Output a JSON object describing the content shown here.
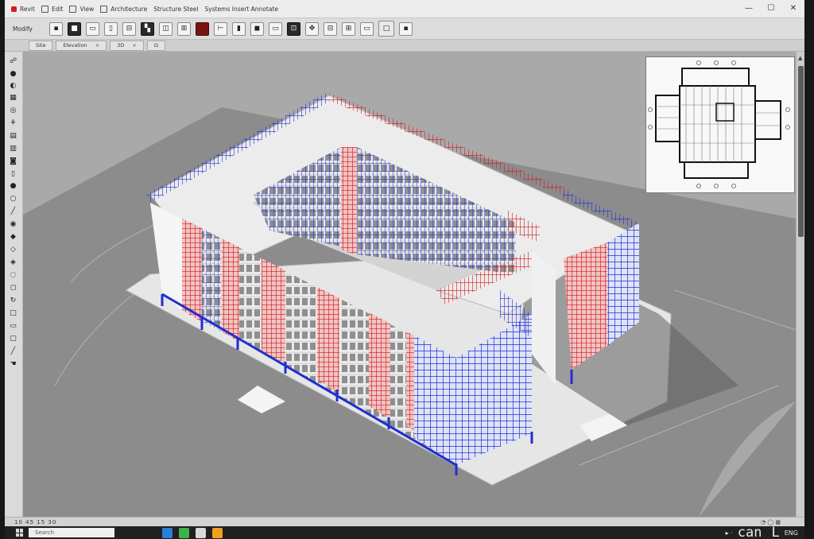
{
  "titlebar": {
    "items": [
      "Revit",
      "Edit",
      "View",
      "Architecture",
      "Structure  Steel",
      "Systems  Insert  Annotate"
    ],
    "controls": [
      "—",
      "☐",
      "✕"
    ]
  },
  "ribbon": {
    "label": "Modify",
    "buttons": [
      "select",
      "move",
      "copy",
      "rotate",
      "align",
      "offset",
      "mirror",
      "array",
      "scale",
      "trim",
      "split",
      "pin",
      "unpin",
      "delete",
      "paint",
      "measure",
      "dimension",
      "tag",
      "section"
    ]
  },
  "tabs": [
    {
      "label": "Site"
    },
    {
      "label": "Elevation"
    },
    {
      "label": "3D"
    }
  ],
  "tabs_close": "×",
  "left_tools": [
    "icons"
  ],
  "statusbar": {
    "coords": "10 45 15 30",
    "icons": "◔ ◯ ▦"
  },
  "taskbar": {
    "search_text": "Search",
    "right_text": "can",
    "right_glyph": "L",
    "right_small": "ENG"
  },
  "colors": {
    "blue_steel": "#1f2fd0",
    "red_steel": "#d41a1a",
    "building_white": "#f2f2f2",
    "ground": "#8d8d8d"
  }
}
